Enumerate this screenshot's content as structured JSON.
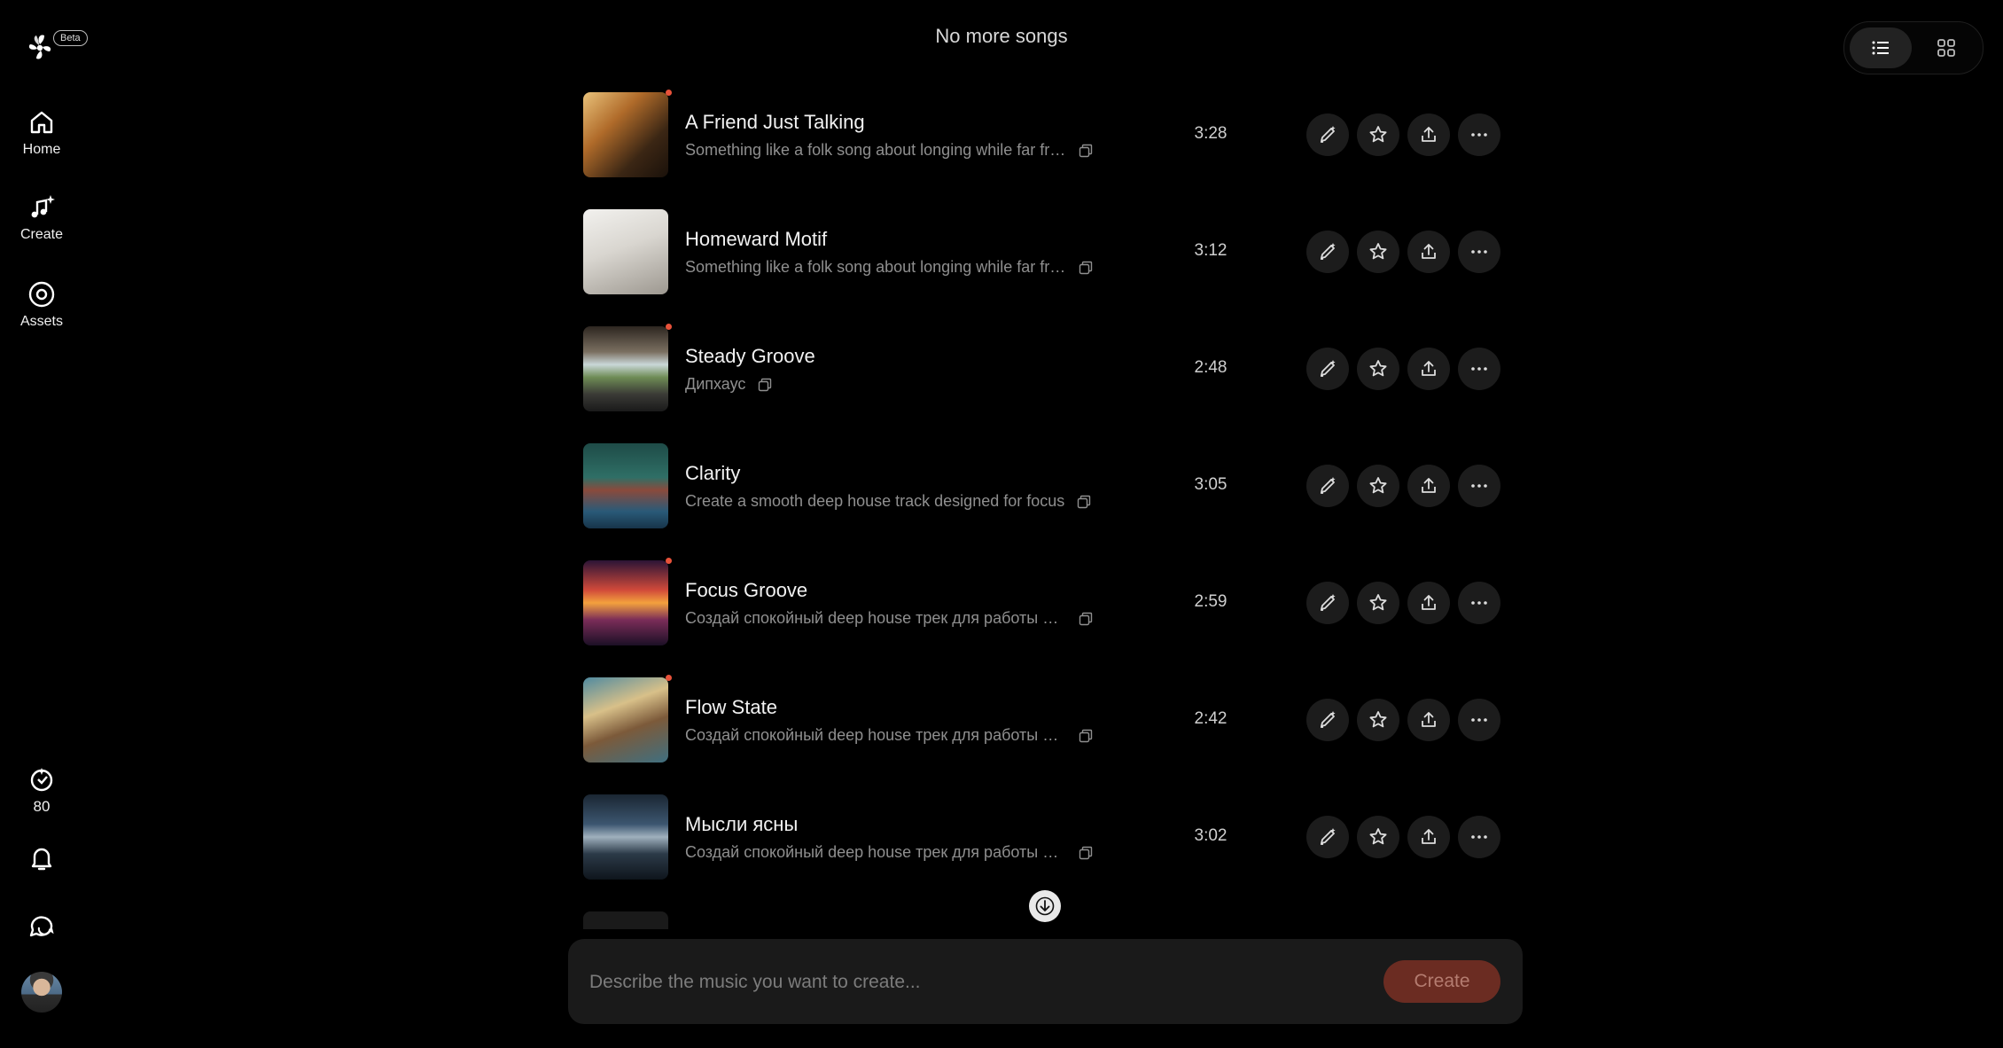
{
  "app": {
    "beta_label": "Beta"
  },
  "nav": {
    "home": "Home",
    "create": "Create",
    "assets": "Assets"
  },
  "credits": {
    "value": "80"
  },
  "header": {
    "message": "No more songs"
  },
  "songs": [
    {
      "title": "A Friend Just Talking",
      "description": "Something like a folk song about longing while far from home",
      "duration": "3:28",
      "new": true
    },
    {
      "title": "Homeward Motif",
      "description": "Something like a folk song about longing while far from home",
      "duration": "3:12",
      "new": false
    },
    {
      "title": "Steady Groove",
      "description": "Дипхаус",
      "duration": "2:48",
      "new": true
    },
    {
      "title": "Clarity",
      "description": "Create a smooth deep house track designed for focus",
      "duration": "3:05",
      "new": false
    },
    {
      "title": "Focus Groove",
      "description": "Создай спокойный deep house трек для работы и концентрации",
      "duration": "2:59",
      "new": true
    },
    {
      "title": "Flow State",
      "description": "Создай спокойный deep house трек для работы и концентрации",
      "duration": "2:42",
      "new": true
    },
    {
      "title": "Мысли ясны",
      "description": "Создай спокойный deep house трек для работы и концентрации",
      "duration": "3:02",
      "new": false
    }
  ],
  "composer": {
    "placeholder": "Describe the music you want to create...",
    "button": "Create"
  },
  "colors": {
    "accent": "#e8523a",
    "create_button": "#6b2c22"
  },
  "icons": [
    "logo-icon",
    "home-icon",
    "create-music-icon",
    "assets-disc-icon",
    "credits-icon",
    "bell-icon",
    "chat-icon",
    "list-view-icon",
    "grid-view-icon",
    "copy-icon",
    "edit-icon",
    "star-icon",
    "share-icon",
    "more-icon",
    "arrow-down-icon"
  ]
}
